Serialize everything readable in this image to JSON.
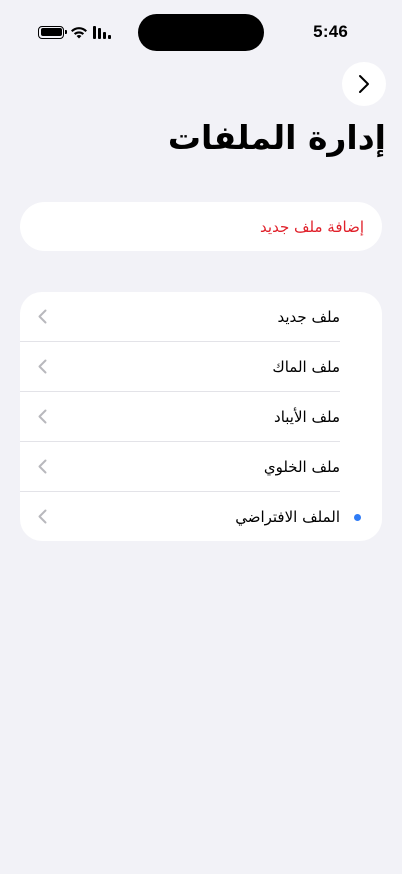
{
  "status_bar": {
    "time": "5:46",
    "icons": [
      "battery-icon",
      "wifi-icon",
      "cellular-signal-icon"
    ]
  },
  "nav": {
    "forward_icon": "chevron-right-icon"
  },
  "page": {
    "title": "إدارة الملفات"
  },
  "add_action": {
    "label": "إضافة ملف جديد",
    "color": "#e0202a"
  },
  "profiles": {
    "items": [
      {
        "label": "ملف جديد",
        "selected": false
      },
      {
        "label": "ملف الماك",
        "selected": false
      },
      {
        "label": "ملف الأيباد",
        "selected": false
      },
      {
        "label": "ملف الخلوي",
        "selected": false
      },
      {
        "label": "الملف الافتراضي",
        "selected": true
      }
    ],
    "selected_indicator_color": "#2f7cf6",
    "row_icon": "chevron-left-icon"
  }
}
